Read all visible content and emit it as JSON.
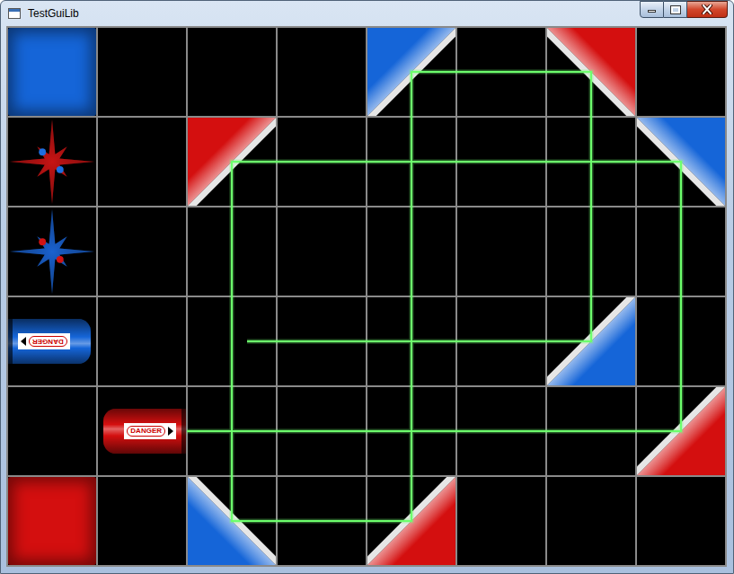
{
  "window": {
    "title": "TestGuiLib"
  },
  "pieces": [
    {
      "kind": "block",
      "color": "#1565d8",
      "row": 0,
      "col": 0
    },
    {
      "kind": "mirror",
      "color": "#1565d8",
      "row": 0,
      "col": 4,
      "corner": "tl"
    },
    {
      "kind": "mirror",
      "color": "#d40f0f",
      "row": 0,
      "col": 6,
      "corner": "tr"
    },
    {
      "kind": "star",
      "color": "#c81414",
      "dot_color": "#1e6ee0",
      "row": 1,
      "col": 0
    },
    {
      "kind": "mirror",
      "color": "#d40f0f",
      "row": 1,
      "col": 2,
      "corner": "tl"
    },
    {
      "kind": "mirror",
      "color": "#1565d8",
      "row": 1,
      "col": 7,
      "corner": "tr"
    },
    {
      "kind": "star",
      "color": "#1a62d0",
      "dot_color": "#d01414",
      "row": 2,
      "col": 0
    },
    {
      "kind": "laser",
      "color": "#1565d8",
      "row": 3,
      "col": 0,
      "direction": "left",
      "label": "DANGER"
    },
    {
      "kind": "mirror",
      "color": "#1565d8",
      "row": 3,
      "col": 6,
      "corner": "br"
    },
    {
      "kind": "laser",
      "color": "#d40f0f",
      "row": 4,
      "col": 1,
      "direction": "right",
      "label": "DANGER"
    },
    {
      "kind": "mirror",
      "color": "#d40f0f",
      "row": 4,
      "col": 7,
      "corner": "br"
    },
    {
      "kind": "block",
      "color": "#d40f0f",
      "row": 5,
      "col": 0
    },
    {
      "kind": "mirror",
      "color": "#1565d8",
      "row": 5,
      "col": 2,
      "corner": "bl"
    },
    {
      "kind": "mirror",
      "color": "#d40f0f",
      "row": 5,
      "col": 4,
      "corner": "br"
    }
  ],
  "beam": {
    "color": "#6dff6d",
    "points": [
      [
        2.0,
        4.5
      ],
      [
        7.5,
        4.5
      ],
      [
        7.5,
        1.5
      ],
      [
        2.5,
        1.5
      ],
      [
        2.5,
        5.5
      ],
      [
        4.5,
        5.5
      ],
      [
        4.5,
        0.5
      ],
      [
        6.5,
        0.5
      ],
      [
        6.5,
        3.5
      ],
      [
        2.67,
        3.5
      ]
    ]
  }
}
